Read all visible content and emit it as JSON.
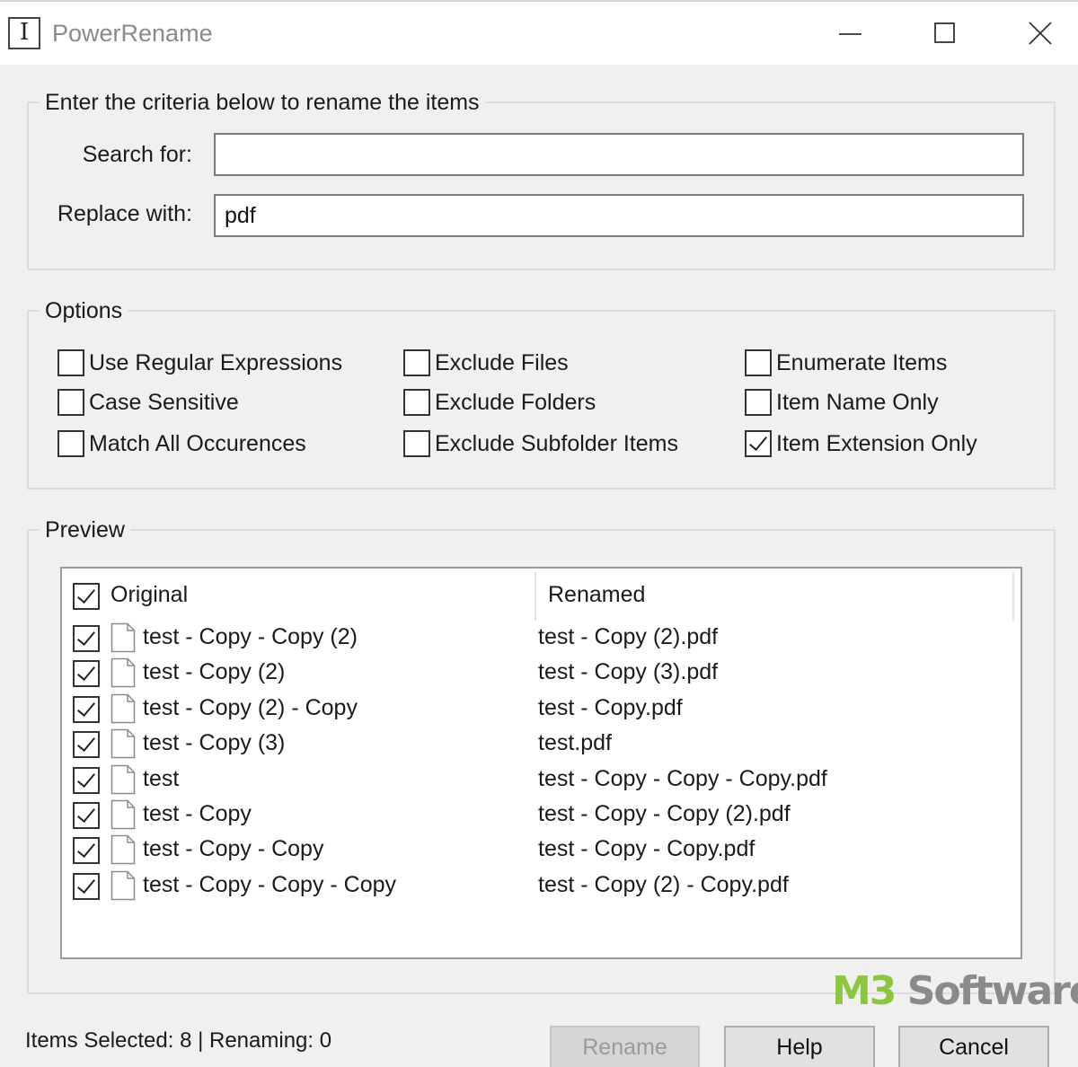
{
  "window": {
    "title": "PowerRename",
    "app_icon_glyph": "I"
  },
  "criteria": {
    "group_title": "Enter the criteria below to rename the items",
    "search_label": "Search for:",
    "search_value": "",
    "replace_label": "Replace with:",
    "replace_value": "pdf"
  },
  "options": {
    "group_title": "Options",
    "use_regex": {
      "label": "Use Regular Expressions",
      "checked": false
    },
    "case_sensitive": {
      "label": "Case Sensitive",
      "checked": false
    },
    "match_all": {
      "label": "Match All Occurences",
      "checked": false
    },
    "exclude_files": {
      "label": "Exclude Files",
      "checked": false
    },
    "exclude_folders": {
      "label": "Exclude Folders",
      "checked": false
    },
    "exclude_subfolder": {
      "label": "Exclude Subfolder Items",
      "checked": false
    },
    "enumerate_items": {
      "label": "Enumerate Items",
      "checked": false
    },
    "item_name_only": {
      "label": "Item Name Only",
      "checked": false
    },
    "item_extension_only": {
      "label": "Item Extension Only",
      "checked": true
    }
  },
  "preview": {
    "group_title": "Preview",
    "header_original": "Original",
    "header_renamed": "Renamed",
    "header_checked": true,
    "rows": [
      {
        "checked": true,
        "original": "test - Copy - Copy (2)",
        "renamed": "test - Copy (2).pdf"
      },
      {
        "checked": true,
        "original": "test - Copy (2)",
        "renamed": "test - Copy (3).pdf"
      },
      {
        "checked": true,
        "original": "test - Copy (2) - Copy",
        "renamed": "test - Copy.pdf"
      },
      {
        "checked": true,
        "original": "test - Copy (3)",
        "renamed": "test.pdf"
      },
      {
        "checked": true,
        "original": "test",
        "renamed": "test - Copy - Copy - Copy.pdf"
      },
      {
        "checked": true,
        "original": "test - Copy",
        "renamed": "test - Copy - Copy (2).pdf"
      },
      {
        "checked": true,
        "original": "test - Copy - Copy",
        "renamed": "test - Copy - Copy.pdf"
      },
      {
        "checked": true,
        "original": "test - Copy - Copy - Copy",
        "renamed": "test - Copy (2) - Copy.pdf"
      }
    ]
  },
  "status": {
    "text": "Items Selected: 8 | Renaming: 0"
  },
  "buttons": {
    "rename": "Rename",
    "help": "Help",
    "cancel": "Cancel"
  },
  "watermark": {
    "part1": "M3",
    "part2": " Software",
    "colors": {
      "accent": "#8cc63f",
      "gray": "#8a8a8a"
    }
  }
}
